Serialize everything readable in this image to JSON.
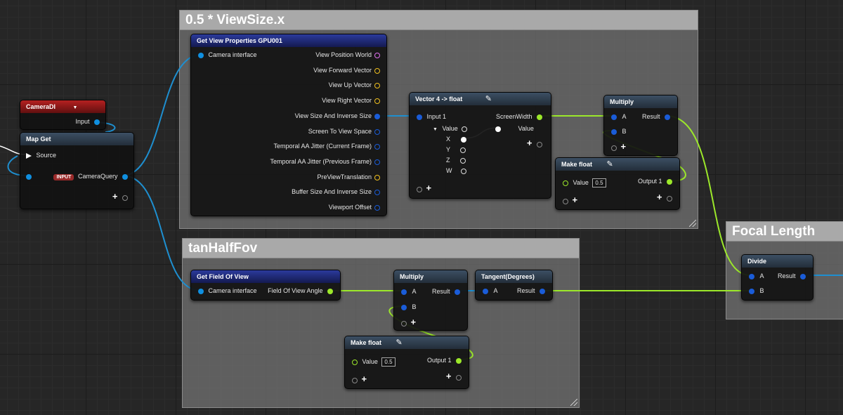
{
  "comments": {
    "viewsize": "0.5 * ViewSize.x",
    "tanhalffov": "tanHalfFov",
    "focal": "Focal Length"
  },
  "camera_di": {
    "title": "CameraDI",
    "input": "Input"
  },
  "map_get": {
    "title": "Map Get",
    "source": "Source",
    "badge": "INPUT",
    "query": "CameraQuery"
  },
  "view_props": {
    "title": "Get View Properties GPU001",
    "input": "Camera interface",
    "outputs": [
      "View Position World",
      "View Forward Vector",
      "View Up Vector",
      "View Right Vector",
      "View Size And Inverse Size",
      "Screen To View Space",
      "Temporal AA Jitter (Current Frame)",
      "Temporal AA Jitter (Previous Frame)",
      "PreViewTranslation",
      "Buffer Size And Inverse Size",
      "Viewport Offset"
    ]
  },
  "vec4": {
    "title": "Vector 4 -> float",
    "input": "Input 1",
    "output": "ScreenWidth",
    "value_in": "Value",
    "value_out": "Value",
    "x": "X",
    "y": "Y",
    "z": "Z",
    "w": "W"
  },
  "multiply1": {
    "title": "Multiply",
    "a": "A",
    "b": "B",
    "result": "Result"
  },
  "make_float1": {
    "title": "Make float",
    "value_label": "Value",
    "value": "0.5",
    "output": "Output 1"
  },
  "fov": {
    "title": "Get Field Of View",
    "input": "Camera interface",
    "output": "Field Of View Angle"
  },
  "multiply2": {
    "title": "Multiply",
    "a": "A",
    "b": "B",
    "result": "Result"
  },
  "tangent": {
    "title": "Tangent(Degrees)",
    "a": "A",
    "result": "Result"
  },
  "make_float2": {
    "title": "Make float",
    "value_label": "Value",
    "value": "0.5",
    "output": "Output 1"
  },
  "divide": {
    "title": "Divide",
    "a": "A",
    "b": "B",
    "result": "Result"
  },
  "colors": {
    "wire_blue": "#1e8fd0",
    "wire_green": "#9ce82a",
    "wire_white": "#ffffff"
  },
  "icons": {
    "edit": "pencil-icon",
    "add_pin": "plus-icon",
    "dropdown": "chevron-down-icon"
  }
}
